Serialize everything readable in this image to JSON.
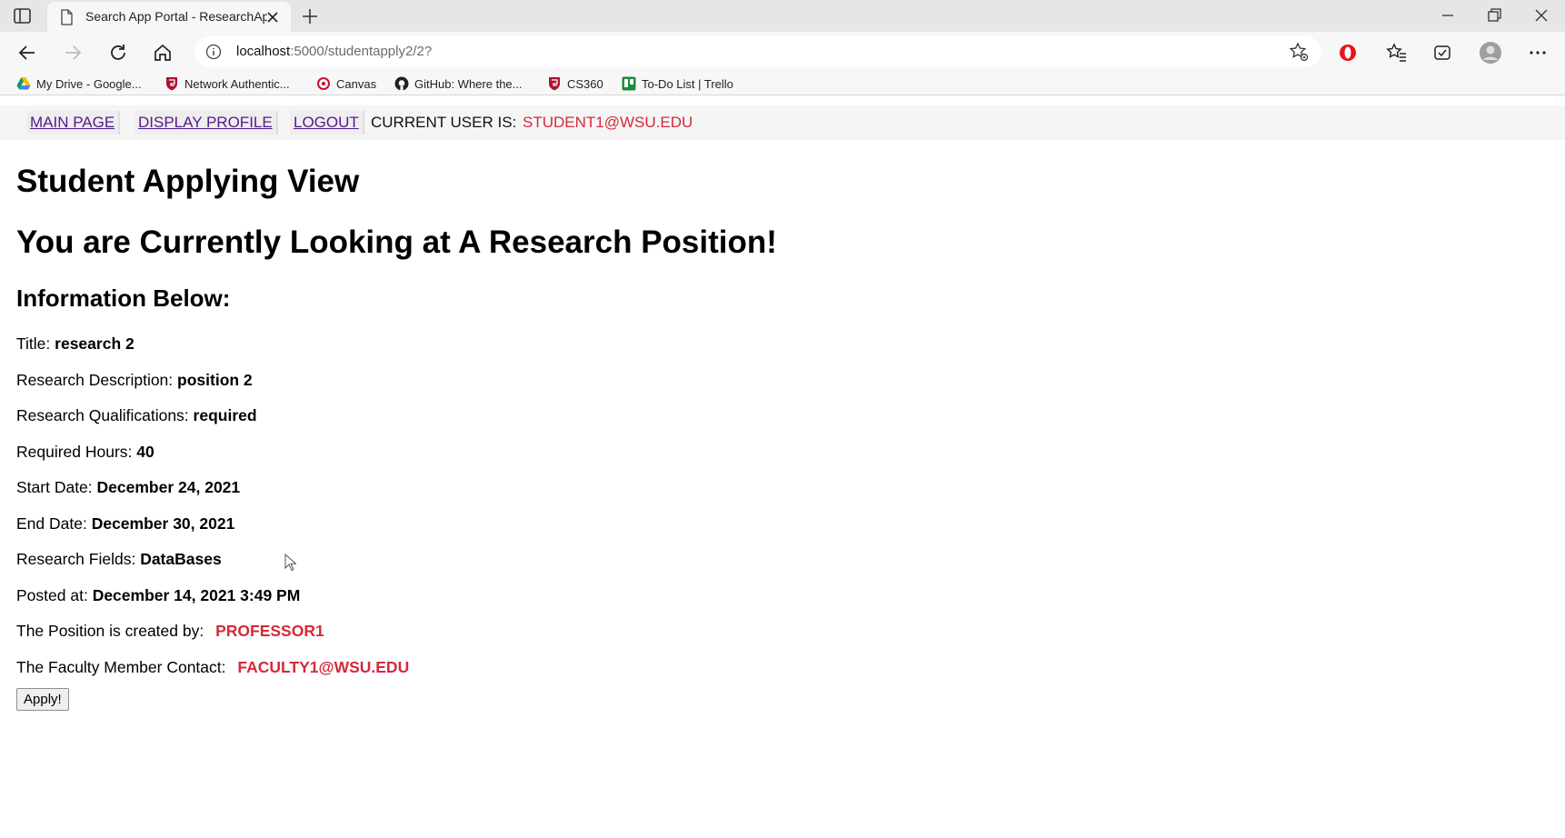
{
  "browser": {
    "tab_title": "Search App Portal - ResearchApp",
    "url_host": "localhost",
    "url_path": ":5000/studentapply2/2?",
    "bookmarks": [
      {
        "label": "My Drive - Google...",
        "icon": "google-drive-icon"
      },
      {
        "label": "Network Authentic...",
        "icon": "wsu-shield-icon"
      },
      {
        "label": "Canvas",
        "icon": "canvas-icon"
      },
      {
        "label": "GitHub: Where the...",
        "icon": "github-icon"
      },
      {
        "label": "CS360",
        "icon": "wsu-shield-icon"
      },
      {
        "label": "To-Do List | Trello",
        "icon": "trello-icon"
      }
    ]
  },
  "nav": {
    "main_page": "MAIN PAGE",
    "display_profile": "DISPLAY PROFILE",
    "logout": "LOGOUT",
    "current_user_label": "CURRENT USER IS:",
    "current_user": "STUDENT1@WSU.EDU"
  },
  "page": {
    "title": "Student Applying View",
    "position_heading": "You are Currently Looking at A Research Position!",
    "info_heading": "Information Below:"
  },
  "position": {
    "title_label": "Title:",
    "title": "research 2",
    "description_label": "Research Description:",
    "description": "position 2",
    "qualifications_label": "Research Qualifications:",
    "qualifications": "required",
    "hours_label": "Required Hours:",
    "hours": "40",
    "start_label": "Start Date:",
    "start_date": "December 24, 2021",
    "end_label": "End Date:",
    "end_date": "December 30, 2021",
    "fields_label": "Research Fields:",
    "fields": "DataBases",
    "posted_label": "Posted at:",
    "posted_at": "December 14, 2021 3:49 PM",
    "created_by_label": "The Position is created by:",
    "created_by": "PROFESSOR1",
    "contact_label": "The Faculty Member Contact:",
    "contact": "FACULTY1@WSU.EDU"
  },
  "apply_button": "Apply!",
  "colors": {
    "accent_red": "#d5293a",
    "visited_link": "#551a8b"
  }
}
